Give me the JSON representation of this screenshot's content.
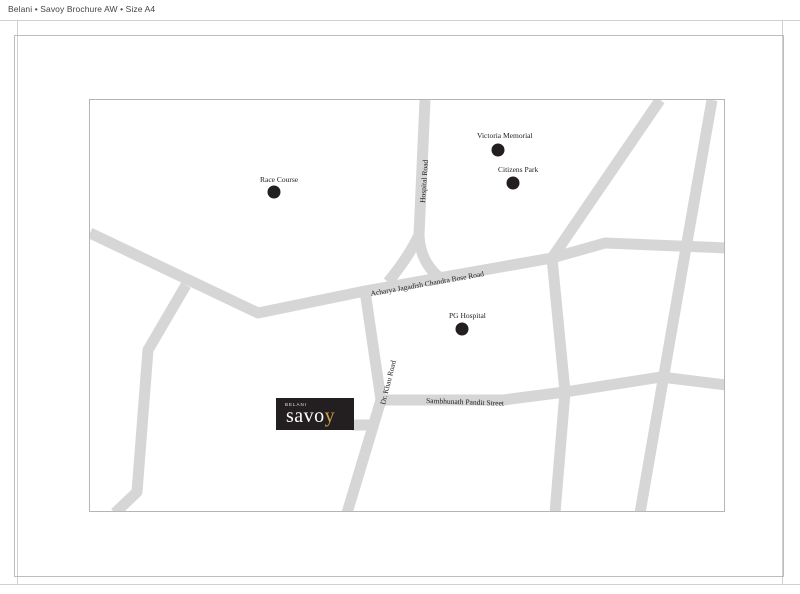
{
  "header": {
    "text": "Belani • Savoy Brochure AW • Size A4"
  },
  "map": {
    "roads": [
      {
        "id": "hospital-road",
        "label": "Hospital Road"
      },
      {
        "id": "ajc-bose-road",
        "label": "Acharya Jagadish Chandra Bose Road"
      },
      {
        "id": "dr-kharu-road",
        "label": "Dr. Khau Road"
      },
      {
        "id": "sambhunath-pandit-street",
        "label": "Sambhunath Pandit Street"
      }
    ],
    "places": [
      {
        "id": "race-course",
        "label": "Race Course"
      },
      {
        "id": "victoria-memorial",
        "label": "Victoria Memorial"
      },
      {
        "id": "citizens-park",
        "label": "Citizens Park"
      },
      {
        "id": "pg-hospital",
        "label": "PG Hospital"
      }
    ],
    "road_color": "#d6d6d6",
    "marker_color": "#231f20"
  },
  "logo": {
    "small_text": "BELANI",
    "main_text": "savo",
    "accent_text": "y",
    "background": "#231f20",
    "accent_color": "#c9a04a"
  }
}
